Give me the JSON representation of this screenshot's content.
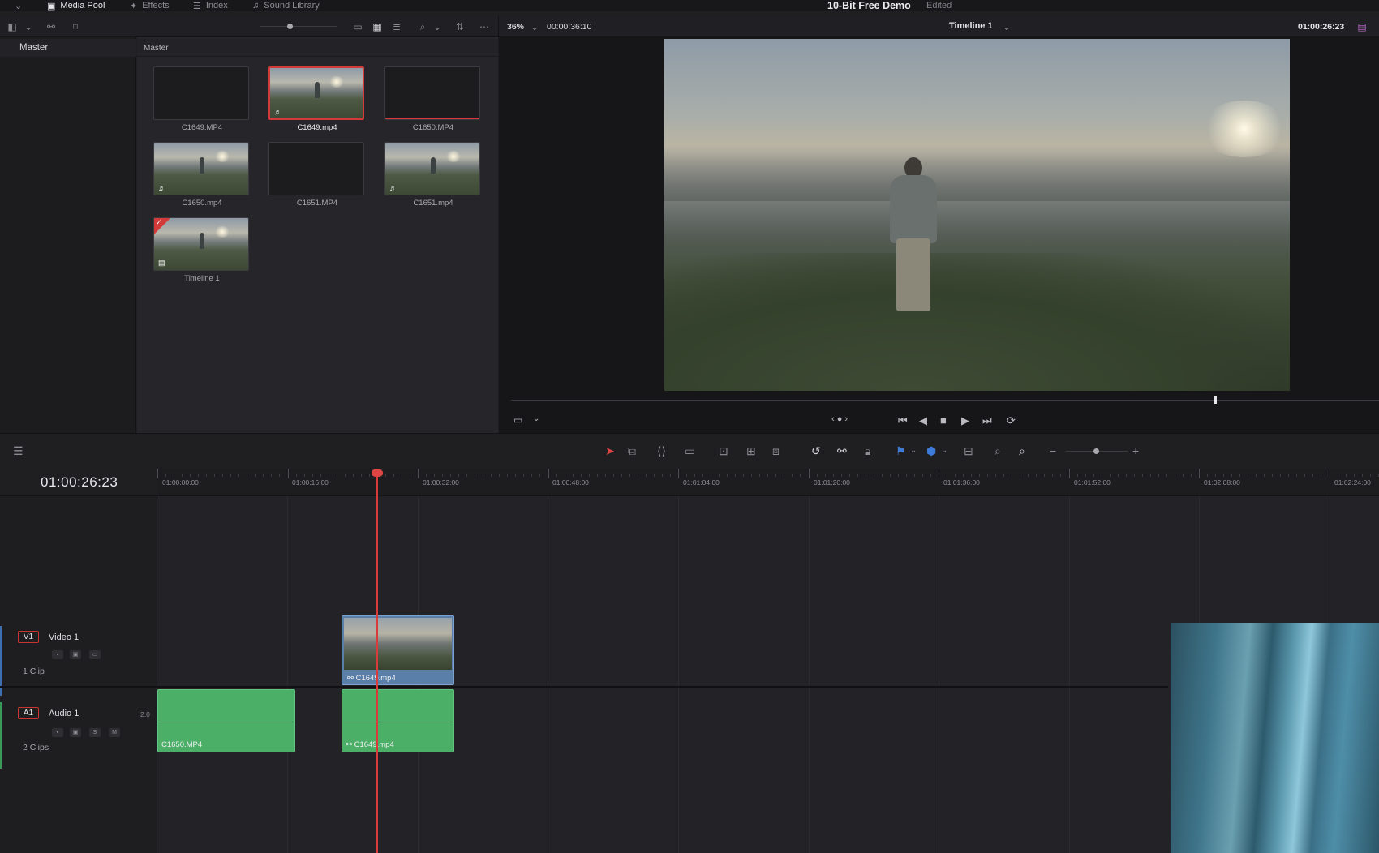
{
  "topbar": {
    "tabs": [
      {
        "label": "Media Pool",
        "icon": "media-pool-icon",
        "active": true
      },
      {
        "label": "Effects",
        "icon": "effects-icon",
        "active": false
      },
      {
        "label": "Index",
        "icon": "index-icon",
        "active": false
      },
      {
        "label": "Sound Library",
        "icon": "sound-library-icon",
        "active": false
      }
    ],
    "project_title": "10-Bit Free Demo",
    "project_status": "Edited"
  },
  "viewer_toolbar": {
    "zoom": "36%",
    "source_timecode": "00:00:36:10",
    "timeline_name": "Timeline 1",
    "record_timecode": "01:00:26:23"
  },
  "bins": {
    "sidebar_header": "Master",
    "pool_header": "Master"
  },
  "clips": [
    {
      "name": "C1649.MP4",
      "has_image": false,
      "audio": false,
      "selected": false,
      "timeline": false
    },
    {
      "name": "C1649.mp4",
      "has_image": true,
      "audio": true,
      "selected": true,
      "timeline": false
    },
    {
      "name": "C1650.MP4",
      "has_image": false,
      "audio": false,
      "selected": false,
      "timeline": false
    },
    {
      "name": "C1650.mp4",
      "has_image": true,
      "audio": true,
      "selected": false,
      "timeline": false
    },
    {
      "name": "C1651.MP4",
      "has_image": false,
      "audio": false,
      "selected": false,
      "timeline": false
    },
    {
      "name": "C1651.mp4",
      "has_image": true,
      "audio": true,
      "selected": false,
      "timeline": false
    },
    {
      "name": "Timeline 1",
      "has_image": true,
      "audio": false,
      "selected": false,
      "timeline": true
    }
  ],
  "viewer": {
    "scrub_position": 0.81
  },
  "timeline": {
    "timecode": "01:00:26:23",
    "ruler_labels": [
      "01:00:00:00",
      "01:00:16:00",
      "01:00:32:00",
      "01:00:48:00",
      "01:01:04:00",
      "01:01:20:00",
      "01:01:36:00",
      "01:01:52:00",
      "01:02:08:00",
      "01:02:24:00"
    ],
    "tracks": {
      "video": {
        "tag": "V1",
        "name": "Video 1",
        "count": "1 Clip"
      },
      "audio": {
        "tag": "A1",
        "name": "Audio 1",
        "count": "2 Clips",
        "channels": "2.0",
        "solo": "S",
        "mute": "M"
      }
    },
    "video_clips": [
      {
        "label": "C1649.mp4"
      }
    ],
    "audio_clips": [
      {
        "label": "C1650.MP4"
      },
      {
        "label": "C1649.mp4"
      }
    ]
  }
}
